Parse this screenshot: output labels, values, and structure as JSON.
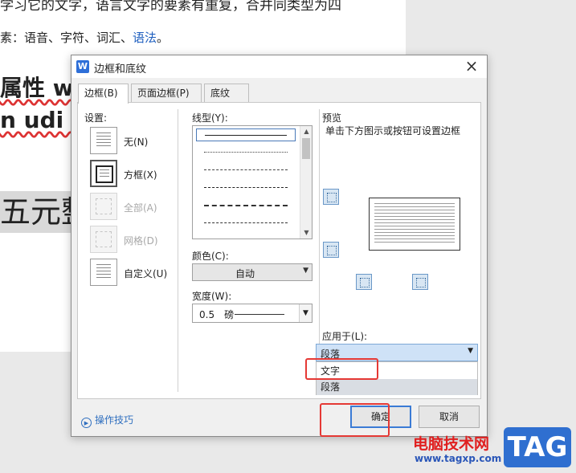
{
  "document": {
    "line1": "学习它的文字，语言文字的要素有重复，合并同类型为四",
    "line2_prefix": "素：语音、字符、词汇、",
    "line2_link": "语法",
    "line2_suffix": "。",
    "big1": "属性 we",
    "big2": "n udi 恩",
    "gray": "五元整"
  },
  "dialog": {
    "title": "边框和底纹",
    "close_glyph": "×",
    "app_icon_letter": "W",
    "tabs": [
      {
        "label": "边框(B)",
        "hotkey": "B"
      },
      {
        "label": "页面边框(P)",
        "hotkey": "P"
      },
      {
        "label": "底纹(S)",
        "hotkey": "S"
      }
    ],
    "settings": {
      "heading": "设置:",
      "items": [
        {
          "label": "无(N)",
          "enabled": true
        },
        {
          "label": "方框(X)",
          "enabled": true,
          "selected": true
        },
        {
          "label": "全部(A)",
          "enabled": false
        },
        {
          "label": "网格(D)",
          "enabled": false
        },
        {
          "label": "自定义(U)",
          "enabled": true
        }
      ]
    },
    "line_style": {
      "heading": "线型(Y):",
      "options": [
        "solid",
        "dotted-fine",
        "dashed-short",
        "dashed",
        "dash-dot",
        "dash-dot-dot"
      ]
    },
    "color": {
      "heading": "颜色(C):",
      "value": "自动"
    },
    "width": {
      "heading": "宽度(W):",
      "value": "0.5　磅"
    },
    "preview": {
      "heading": "预览",
      "hint": "单击下方图示或按钮可设置边框"
    },
    "apply_to": {
      "heading": "应用于(L):",
      "value": "段落",
      "options": [
        "文字",
        "段落"
      ]
    },
    "tips_label": "操作技巧",
    "ok_label": "确定",
    "cancel_label": "取消"
  },
  "watermark": {
    "site_name": "电脑技术网",
    "url": "www.tagxp.com",
    "tag": "TAG"
  },
  "colors": {
    "accent": "#3a7bd5",
    "highlight_red": "#e53935",
    "dropdown_selected": "#cfe2f7"
  }
}
